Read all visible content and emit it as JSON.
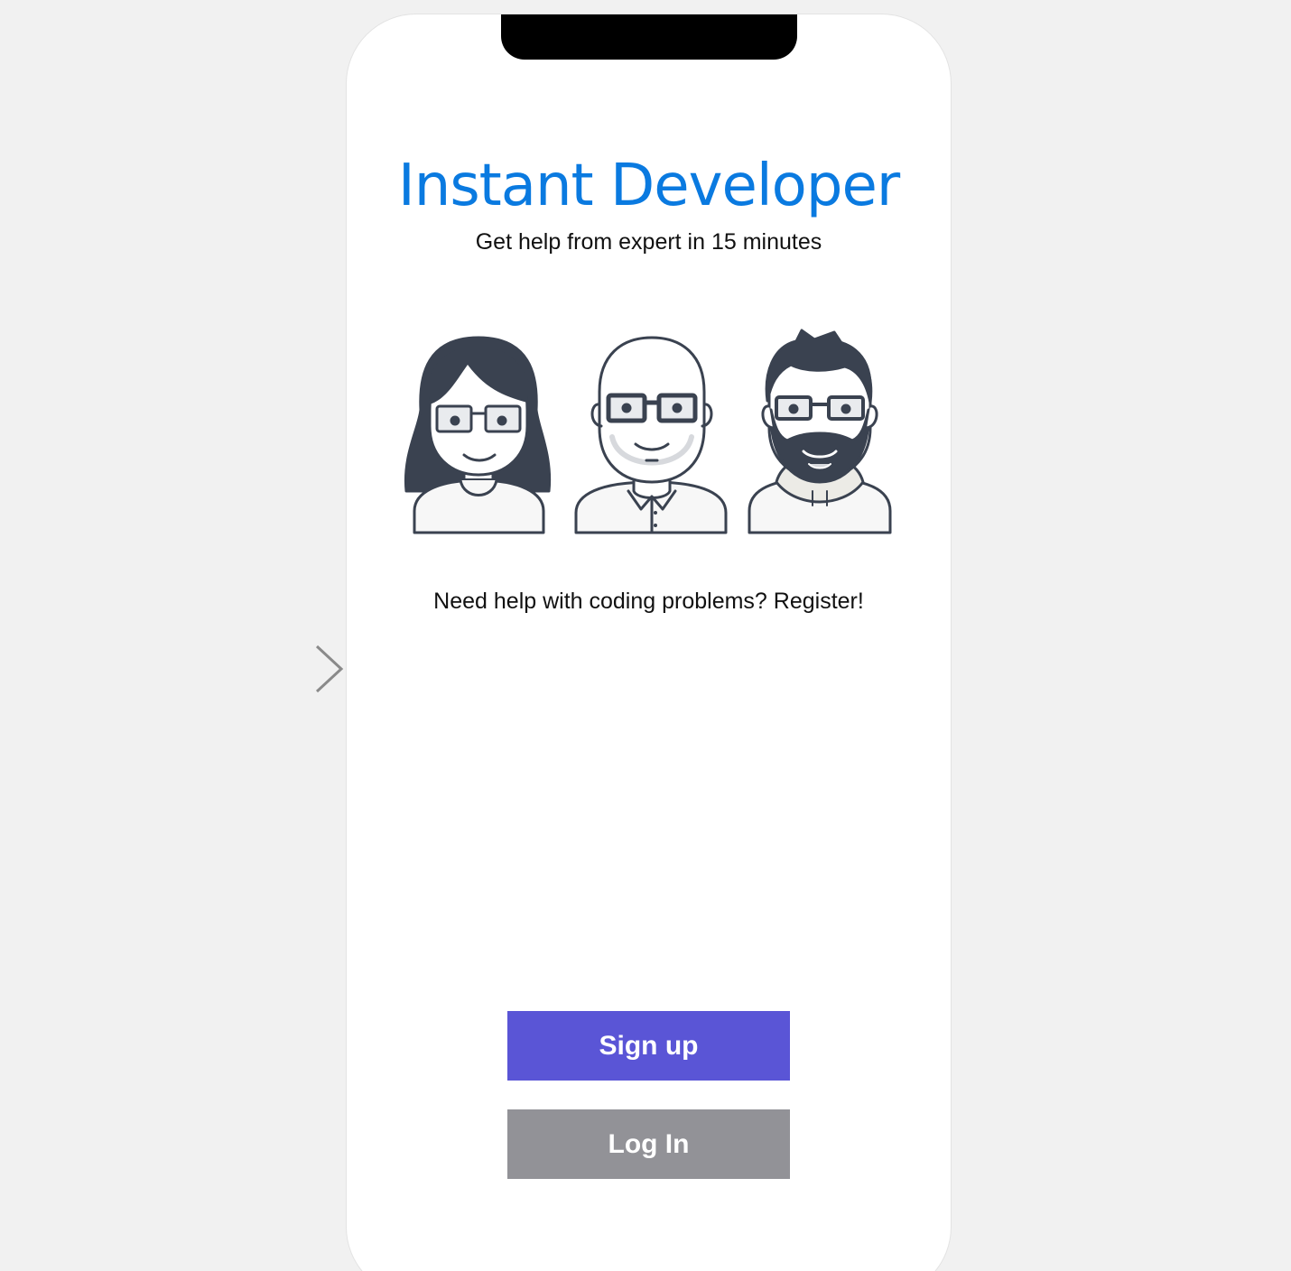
{
  "app": {
    "title": "Instant Developer",
    "subtitle": "Get help from expert in 15 minutes",
    "tagline": "Need help with coding problems? Register!"
  },
  "buttons": {
    "signup_label": "Sign up",
    "login_label": "Log In"
  },
  "icons": {
    "entry_arrow": "arrow-right-icon",
    "avatar_1": "woman-developer-avatar",
    "avatar_2": "bald-developer-avatar",
    "avatar_3": "bearded-developer-avatar"
  },
  "colors": {
    "background": "#f1f1f1",
    "screen": "#ffffff",
    "title": "#0a7ae0",
    "signup_button": "#5a55d6",
    "login_button": "#929297",
    "illustration_ink": "#3a4250"
  }
}
